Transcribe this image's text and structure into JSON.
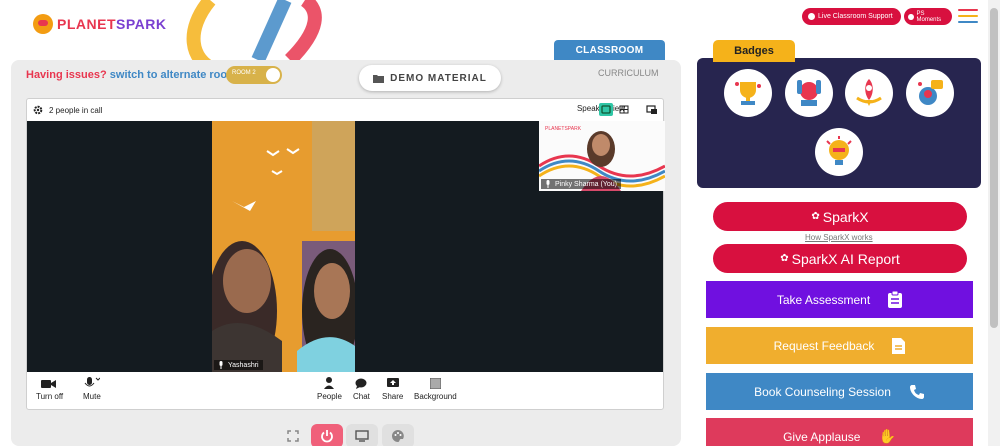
{
  "header": {
    "logo_text_1": "PLANET",
    "logo_text_2": "SPARK",
    "live_support_label": "Live Classroom Support",
    "ps_moments_label": "PS Moments"
  },
  "classroom": {
    "tab_label": "CLASSROOM",
    "curriculum_label": "CURRICULUM",
    "issues_text": "Having issues?",
    "alternate_room_link": "switch to alternate room",
    "room_toggle_label": "ROOM 2",
    "demo_material_label": "DEMO MATERIAL"
  },
  "call": {
    "people_count_text": "2 people in call",
    "speaker_view_label": "Speaker view",
    "main_participant": "Yashashri",
    "self_participant": "Pinky Sharma (You)",
    "controls": {
      "turn_off": "Turn off",
      "mute": "Mute",
      "people": "People",
      "chat": "Chat",
      "share": "Share",
      "background": "Background"
    }
  },
  "badges": {
    "tab_label": "Badges",
    "icons": [
      "trophy-badge-icon",
      "hands-up-badge-icon",
      "rocket-badge-icon",
      "speaking-badge-icon",
      "idea-badge-icon"
    ]
  },
  "sparkx": {
    "sparkx_label": "SparkX",
    "how_link": "How SparkX works",
    "ai_report_label": "SparkX AI Report"
  },
  "actions": {
    "take_assessment": "Take Assessment",
    "request_feedback": "Request Feedback",
    "book_counseling": "Book Counseling Session",
    "give_applause": "Give Applause"
  },
  "colors": {
    "brand_red": "#d8103f",
    "purple": "#7010e0",
    "orange": "#f0ae2e",
    "blue": "#3f88c5",
    "pink": "#de3a5c",
    "badges_bg": "#27254f",
    "badges_tab": "#f5b21a"
  }
}
